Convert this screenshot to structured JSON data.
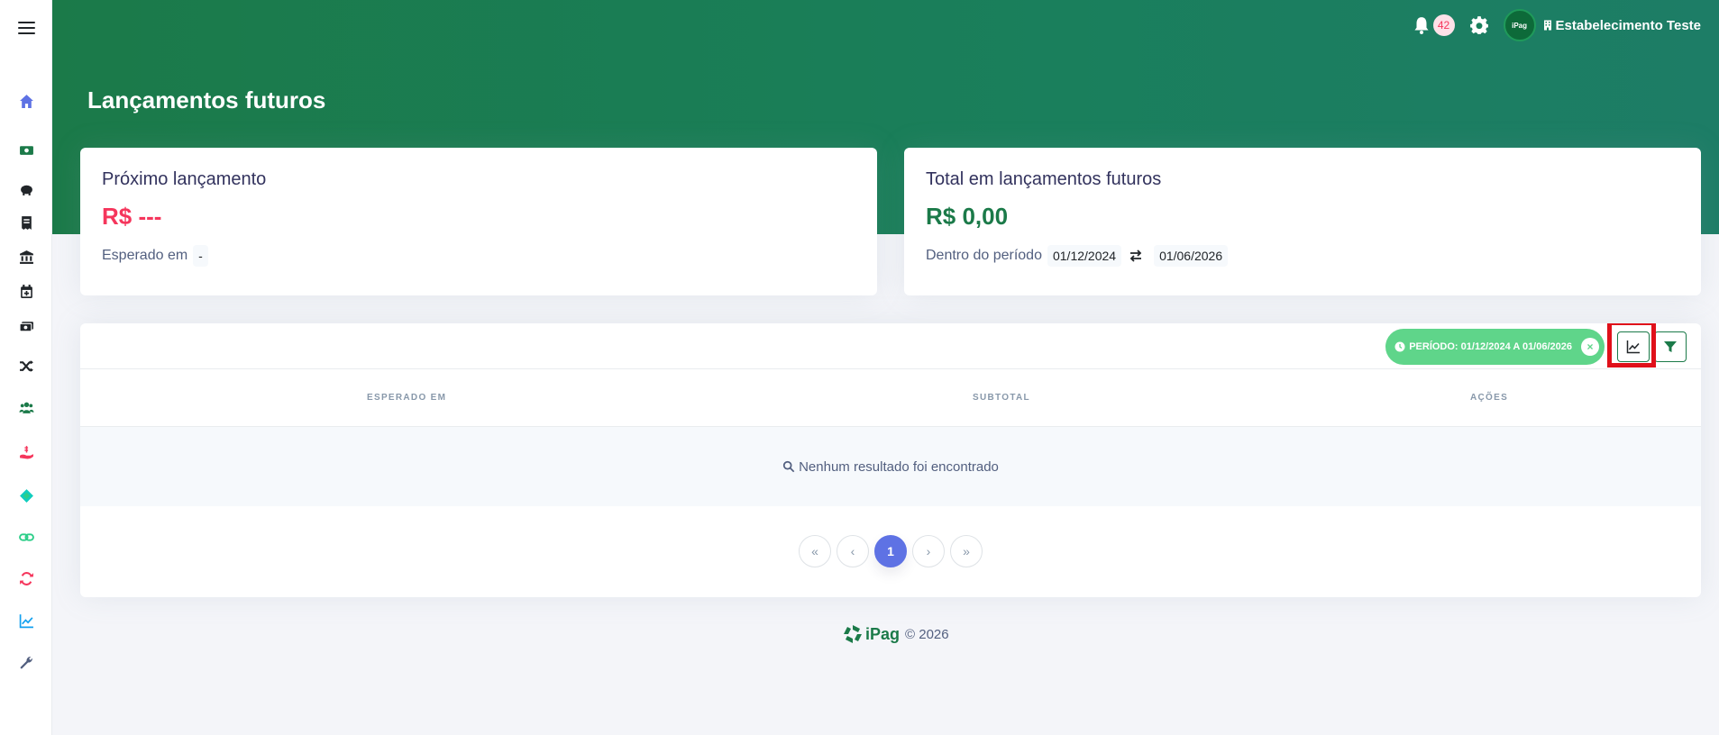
{
  "header": {
    "page_title": "Lançamentos futuros",
    "notification_count": "42",
    "avatar_text": "iPag",
    "establishment": "Estabelecimento Teste"
  },
  "sidebar": {
    "items": [
      {
        "icon": "home-icon",
        "color": "#5e72e4"
      },
      {
        "icon": "money-bill-icon",
        "color": "#2dce89"
      },
      {
        "icon": "piggy-bank-icon",
        "color": "#212529"
      },
      {
        "icon": "receipt-icon",
        "color": "#212529"
      },
      {
        "icon": "bank-icon",
        "color": "#212529"
      },
      {
        "icon": "calendar-plus-icon",
        "color": "#212529"
      },
      {
        "icon": "money-bills-icon",
        "color": "#212529"
      },
      {
        "icon": "shuffle-icon",
        "color": "#212529"
      },
      {
        "icon": "users-icon",
        "color": "#1b7a49"
      },
      {
        "icon": "hand-holding-dollar-icon",
        "color": "#f5365c"
      },
      {
        "icon": "diamond-icon",
        "color": "#11cdbe"
      },
      {
        "icon": "link-icon",
        "color": "#2dce89"
      },
      {
        "icon": "sync-icon",
        "color": "#f5365c"
      },
      {
        "icon": "chart-line-icon",
        "color": "#11a0ef"
      },
      {
        "icon": "wrench-icon",
        "color": "#525f7f"
      }
    ]
  },
  "cards": {
    "next": {
      "label": "Próximo lançamento",
      "value": "R$ ---",
      "sub_label": "Esperado em",
      "sub_value": "-"
    },
    "total": {
      "label": "Total em lançamentos futuros",
      "value": "R$ 0,00",
      "sub_label": "Dentro do período",
      "date_from": "01/12/2024",
      "date_to": "01/06/2026"
    }
  },
  "table": {
    "period_chip": "PERÍODO: 01/12/2024 A 01/06/2026",
    "chip_close": "×",
    "columns": [
      "ESPERADO EM",
      "SUBTOTAL",
      "AÇÕES"
    ],
    "empty_message": "Nenhum resultado foi encontrado",
    "pagination": [
      "«",
      "‹",
      "1",
      "›",
      "»"
    ]
  },
  "footer": {
    "brand": "iPag",
    "copyright": "© 2026"
  },
  "colors": {
    "brand_green": "#1b7a49",
    "red_value": "#f5365c",
    "green_value": "#1b7a49",
    "chip": "#5fd58a",
    "active_page": "#5e72e4"
  }
}
